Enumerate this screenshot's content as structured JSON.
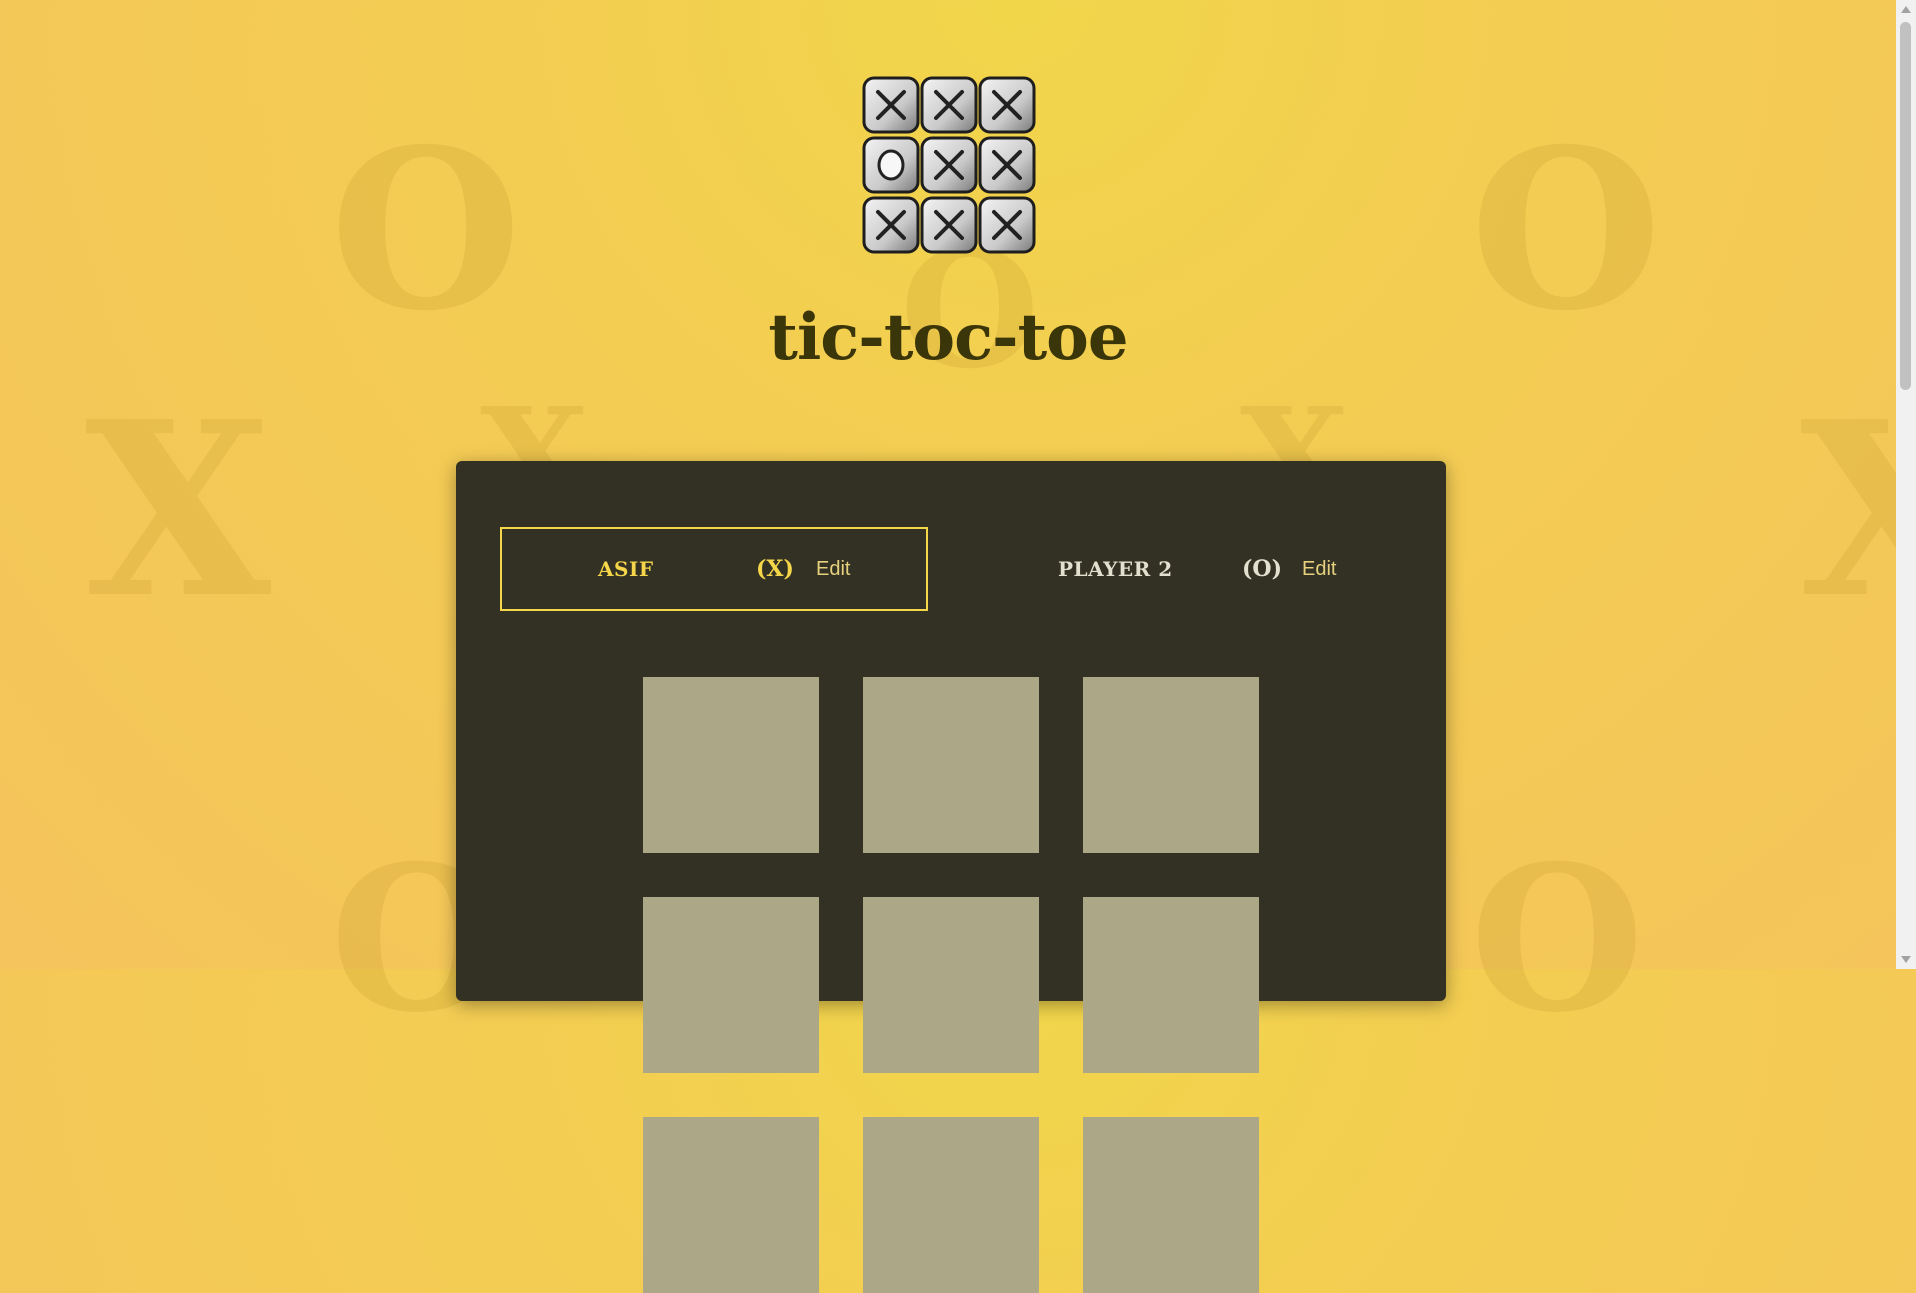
{
  "app": {
    "title": "tic-toc-toe"
  },
  "logo": {
    "icon": "tic-tac-toe-tiles-icon",
    "tiles": [
      "X",
      "X",
      "X",
      "O",
      "X",
      "X",
      "X",
      "X",
      "X"
    ]
  },
  "players": [
    {
      "name": "ASIF",
      "symbol": "(X)",
      "edit_label": "Edit",
      "active": true
    },
    {
      "name": "PLAYER 2",
      "symbol": "(O)",
      "edit_label": "Edit",
      "active": false
    }
  ],
  "board": {
    "cells": [
      "",
      "",
      "",
      "",
      "",
      "",
      "",
      "",
      ""
    ]
  },
  "colors": {
    "background": "#f3cd52",
    "panel": "#333123",
    "active_accent": "#f5d64a",
    "cell": "#aca787",
    "title": "#3b3609"
  }
}
